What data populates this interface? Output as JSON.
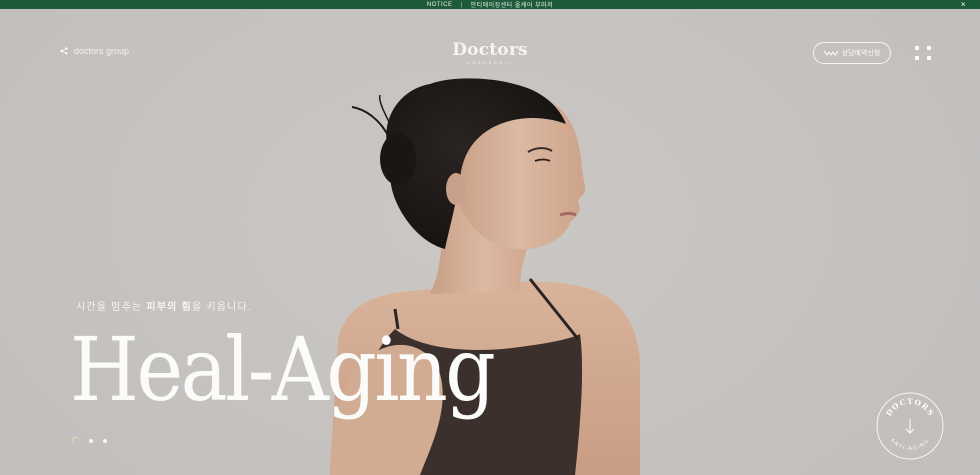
{
  "notice": {
    "label": "NOTICE",
    "separator": "|",
    "text": "안티에이징센터 올케어 부마저",
    "close_glyph": "×"
  },
  "header": {
    "group_link": "doctors group",
    "logo_main": "Doctors",
    "logo_sub": "GAROSUGIL",
    "reserve_button": "상담예약신청"
  },
  "hero": {
    "tagline_pre": "시간을 멈추는 ",
    "tagline_bold": "피부의 힘",
    "tagline_post": "을 키웁니다.",
    "headline": "Heal-Aging",
    "slides_count": 3,
    "active_slide": 1
  },
  "badge": {
    "text_top": "DOCTORS",
    "text_bottom": "ANTI-AGING",
    "arrow": "↓"
  },
  "colors": {
    "notice_bg": "#1e5b3a",
    "hero_bg": "#c6c3c1",
    "accent_dot": "#e8d9a8",
    "text": "#ffffff"
  },
  "icons": {
    "share": "share-icon",
    "wave": "wave-icon",
    "menu": "grid-menu-icon",
    "close": "close-icon",
    "scroll": "arrow-down-icon"
  }
}
